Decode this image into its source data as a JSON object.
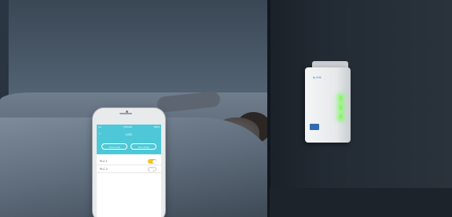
{
  "adapter": {
    "brand": "tp-link",
    "led_color": "#7dff5a"
  },
  "phone": {
    "status_carrier": "•••• ",
    "status_time": "1:00 AM",
    "status_battery": "100%",
    "app_title": "LED",
    "back_icon": "chevron-left-icon",
    "buttons": [
      {
        "label": "Turn on all"
      },
      {
        "label": "Turn off all"
      }
    ],
    "rows": [
      {
        "label": "PLC 1",
        "state": "on"
      },
      {
        "label": "PLC 2",
        "state": "off"
      }
    ],
    "accent_color": "#4ec8d8",
    "toggle_on_color": "#f5c518"
  }
}
